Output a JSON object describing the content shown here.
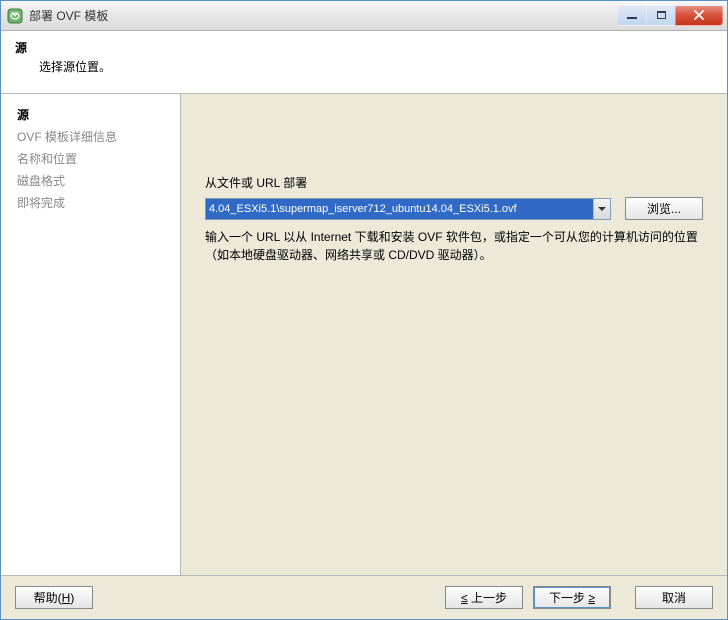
{
  "window": {
    "title": "部署 OVF 模板"
  },
  "header": {
    "title": "源",
    "subtitle": "选择源位置。"
  },
  "nav": {
    "items": [
      {
        "label": "源",
        "active": true
      },
      {
        "label": "OVF 模板详细信息",
        "active": false
      },
      {
        "label": "名称和位置",
        "active": false
      },
      {
        "label": "磁盘格式",
        "active": false
      },
      {
        "label": "即将完成",
        "active": false
      }
    ]
  },
  "content": {
    "deploy_label": "从文件或 URL 部署",
    "url_value": "4.04_ESXi5.1\\supermap_iserver712_ubuntu14.04_ESXi5.1.ovf",
    "browse_label": "浏览...",
    "help_text": "输入一个 URL 以从 Internet 下载和安装 OVF 软件包，或指定一个可从您的计算机访问的位置（如本地硬盘驱动器、网络共享或 CD/DVD 驱动器）。"
  },
  "footer": {
    "help": "帮助",
    "help_key": "H",
    "back": "上一步",
    "next_prefix": "下一步",
    "cancel": "取消"
  }
}
